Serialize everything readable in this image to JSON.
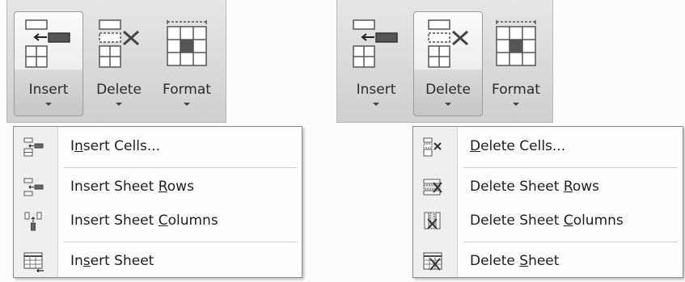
{
  "left_panel": {
    "ribbon": {
      "insert_label": "Insert",
      "delete_label": "Delete",
      "format_label": "Format"
    },
    "menu": {
      "items": [
        {
          "label": "Insert Cells...",
          "pre": "I",
          "key": "n",
          "post": "sert Cells..."
        },
        {
          "label": "Insert Sheet Rows",
          "pre": "Insert Sheet ",
          "key": "R",
          "post": "ows"
        },
        {
          "label": "Insert Sheet Columns",
          "pre": "Insert Sheet ",
          "key": "C",
          "post": "olumns"
        },
        {
          "label": "Insert Sheet",
          "pre": "In",
          "key": "s",
          "post": "ert Sheet"
        }
      ]
    }
  },
  "right_panel": {
    "ribbon": {
      "insert_label": "Insert",
      "delete_label": "Delete",
      "format_label": "Format"
    },
    "menu": {
      "items": [
        {
          "label": "Delete Cells...",
          "pre": "",
          "key": "D",
          "post": "elete Cells..."
        },
        {
          "label": "Delete Sheet Rows",
          "pre": "Delete Sheet ",
          "key": "R",
          "post": "ows"
        },
        {
          "label": "Delete Sheet Columns",
          "pre": "Delete Sheet ",
          "key": "C",
          "post": "olumns"
        },
        {
          "label": "Delete Sheet",
          "pre": "Delete ",
          "key": "S",
          "post": "heet"
        }
      ]
    }
  }
}
